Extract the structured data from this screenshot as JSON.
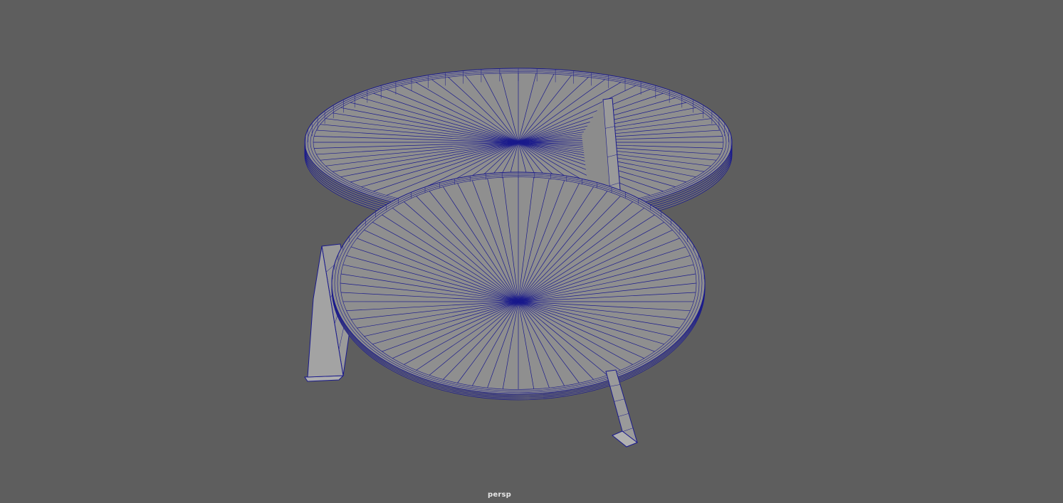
{
  "viewport": {
    "camera_name": "persp",
    "background_color": "#5e5e5e",
    "wireframe_color": "#1a1a8c",
    "shaded_color": "#8f8f8f",
    "radial_segments": 72,
    "objects": [
      "table-top",
      "lower-shelf",
      "leg-left",
      "leg-back-right",
      "leg-front-right"
    ]
  }
}
